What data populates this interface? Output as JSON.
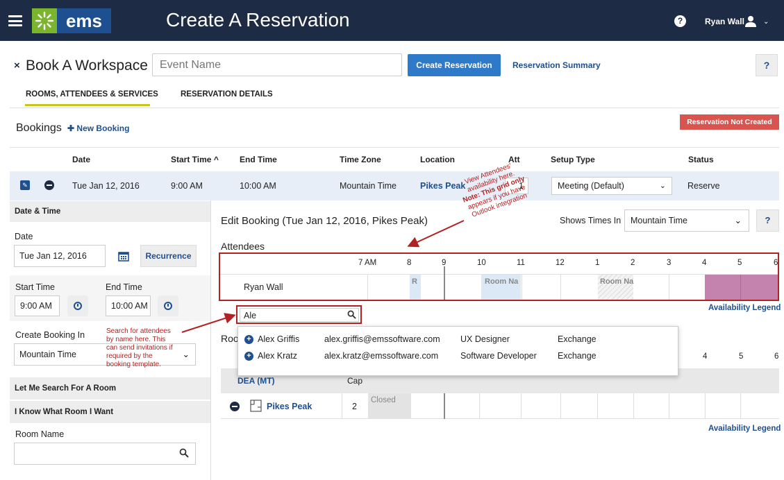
{
  "topbar": {
    "app_name": "ems",
    "title": "Create A Reservation",
    "help": "?",
    "user_name": "Ryan Wall"
  },
  "header": {
    "title": "Book A Workspace",
    "close": "×",
    "event_placeholder": "Event Name",
    "create_button": "Create Reservation",
    "summary_link": "Reservation Summary",
    "help": "?"
  },
  "tabs": [
    {
      "label": "ROOMS, ATTENDEES & SERVICES",
      "active": true
    },
    {
      "label": "RESERVATION DETAILS",
      "active": false
    }
  ],
  "bookings": {
    "title": "Bookings",
    "new_booking": "New Booking",
    "status_badge": "Reservation Not Created",
    "columns": {
      "date": "Date",
      "start": "Start Time",
      "sort": "^",
      "end": "End Time",
      "tz": "Time Zone",
      "location": "Location",
      "att": "Att",
      "setup": "Setup Type",
      "status": "Status"
    },
    "row": {
      "date": "Tue Jan 12, 2016",
      "start": "9:00 AM",
      "end": "10:00 AM",
      "tz": "Mountain Time",
      "location": "Pikes Peak",
      "att": "1",
      "setup": "Meeting (Default)",
      "status": "Reserve"
    }
  },
  "left": {
    "dt_header": "Date & Time",
    "date_label": "Date",
    "date_value": "Tue Jan 12, 2016",
    "recurrence": "Recurrence",
    "start_label": "Start Time",
    "start_value": "9:00 AM",
    "end_label": "End Time",
    "end_value": "10:00 AM",
    "create_in_label": "Create Booking In",
    "create_in_value": "Mountain Time",
    "search_room": "Let Me Search For A Room",
    "know_room": "I Know What Room I Want",
    "room_name_label": "Room Name"
  },
  "edit": {
    "title": "Edit Booking (Tue Jan 12, 2016, Pikes Peak)",
    "shows_times": "Shows Times In",
    "tz_value": "Mountain Time",
    "help": "?",
    "attendees_title": "Attendees",
    "time_ticks": [
      "7 AM",
      "8",
      "9",
      "10",
      "11",
      "12",
      "1",
      "2",
      "3",
      "4",
      "5",
      "6"
    ],
    "attendee": "Ryan Wall",
    "cell_r": "R",
    "cell_room1": "Room Na",
    "cell_room2": "Room Na",
    "availability_legend": "Availability Legend",
    "search_value": "Ale",
    "results": [
      {
        "name": "Alex Griffis",
        "email": "alex.griffis@emssoftware.com",
        "title": "UX Designer",
        "source": "Exchange"
      },
      {
        "name": "Alex Kratz",
        "email": "alex.kratz@emssoftware.com",
        "title": "Software Developer",
        "source": "Exchange"
      }
    ],
    "rooms_title": "Roo",
    "room_ticks": [
      "3",
      "4",
      "5",
      "6"
    ],
    "room_group": "DEA (MT)",
    "cap_label": "Cap",
    "room": {
      "name": "Pikes Peak",
      "cap": "2",
      "closed": "Closed"
    },
    "availability_legend2": "Availability Legend"
  },
  "notes": {
    "note1": [
      "View Attendees'",
      "availability here.",
      "Note: This grid only",
      "appears if you have",
      "Outlook integration"
    ],
    "note2": [
      "Search for attendees",
      "by name here. This",
      "can send invitations if",
      "required by the",
      "booking template."
    ]
  },
  "icons": [
    "menu-icon",
    "logo-icon",
    "help-icon",
    "user-icon",
    "chevron-down-icon",
    "close-icon",
    "plus-icon",
    "edit-icon",
    "minus-icon",
    "calendar-icon",
    "clock-icon",
    "search-icon",
    "room-icon"
  ]
}
